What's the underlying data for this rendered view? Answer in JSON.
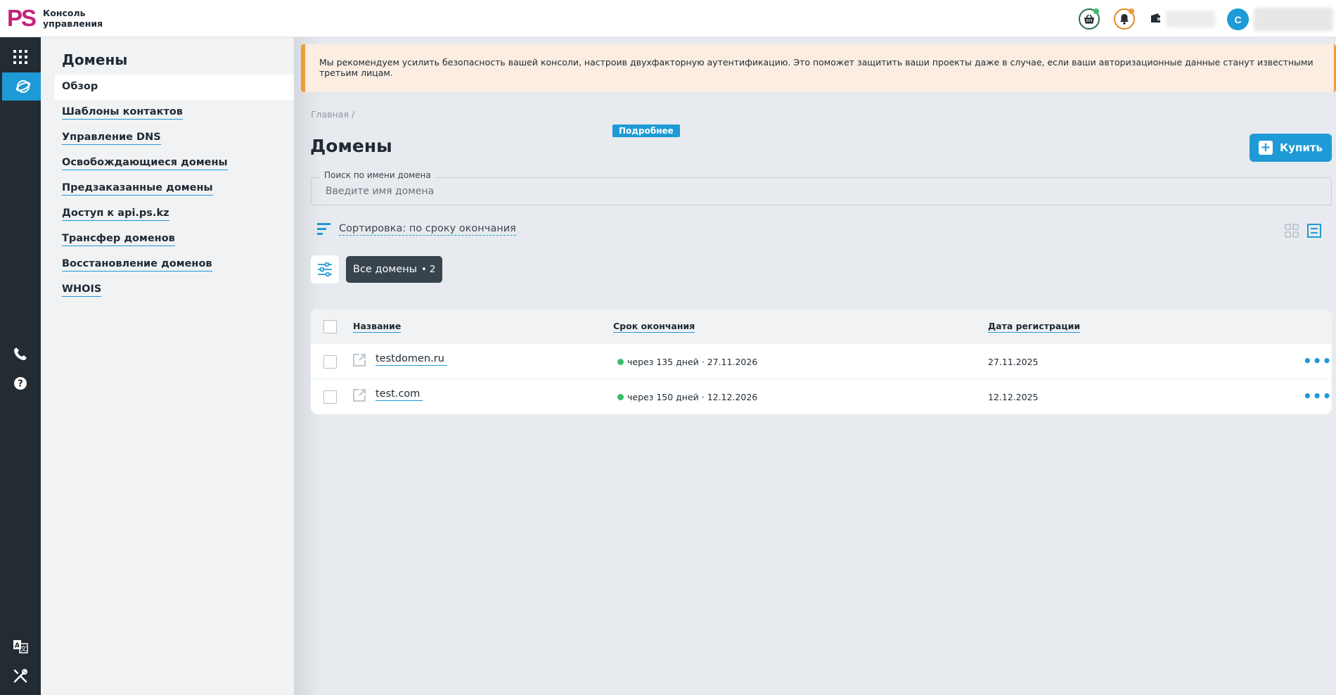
{
  "header": {
    "logo_mark": "PS",
    "logo_line1": "Консоль",
    "logo_line2": "управления",
    "avatar_initial": "С"
  },
  "sidebar": {
    "title": "Домены",
    "items": [
      {
        "label": "Обзор",
        "active": true
      },
      {
        "label": "Шаблоны контактов"
      },
      {
        "label": "Управление DNS"
      },
      {
        "label": "Освобождающиеся домены"
      },
      {
        "label": "Предзаказанные домены"
      },
      {
        "label": "Доступ к api.ps.kz"
      },
      {
        "label": "Трансфер доменов"
      },
      {
        "label": "Восстановление доменов"
      },
      {
        "label": "WHOIS"
      }
    ]
  },
  "alert": {
    "text": "Мы рекомендуем усилить безопасность вашей консоли, настроив двухфакторную аутентификацию. Это поможет защитить ваши проекты даже в случае, если ваши авторизационные данные станут известными третьим лицам.",
    "button": "Подробнее"
  },
  "breadcrumb": "Главная  /",
  "page_title": "Домены",
  "buy_button": "Купить",
  "search": {
    "label": "Поиск по имени домена",
    "placeholder": "Введите имя домена",
    "value": ""
  },
  "sort_label": "Сортировка: по сроку окончания",
  "filter_chip": {
    "label": "Все домены",
    "count": "• 2"
  },
  "table": {
    "columns": [
      "Название",
      "Срок окончания",
      "Дата регистрации"
    ],
    "rows": [
      {
        "name": "testdomen.ru",
        "expires": "через 135 дней  ·  27.11.2026",
        "registered": "27.11.2025"
      },
      {
        "name": "test.com",
        "expires": "через 150 дней  ·  12.12.2026",
        "registered": "12.12.2025"
      }
    ]
  },
  "colors": {
    "accent": "#1e9ad6",
    "brand": "#c0247a",
    "warning": "#ef9a3a",
    "rail": "#232b33",
    "status_ok": "#3dbb6b"
  },
  "icons": [
    "basket-icon",
    "bell-icon",
    "wallet-icon",
    "apps-grid-icon",
    "domains-globe-icon",
    "phone-icon",
    "help-icon",
    "translate-icon",
    "tools-icon",
    "sort-icon",
    "grid-view-icon",
    "list-view-icon",
    "filter-icon",
    "external-link-icon",
    "more-icon"
  ]
}
